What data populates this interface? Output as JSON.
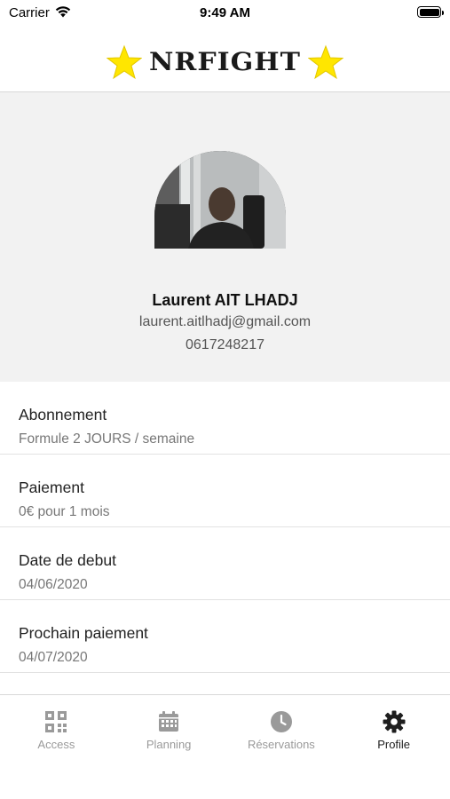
{
  "status_bar": {
    "carrier": "Carrier",
    "time": "9:49 AM"
  },
  "header": {
    "logo_text": "NRFIGHT"
  },
  "profile": {
    "name": "Laurent AIT LHADJ",
    "email": "laurent.aitlhadj@gmail.com",
    "phone": "0617248217"
  },
  "info": [
    {
      "label": "Abonnement",
      "value": "Formule 2 JOURS / semaine"
    },
    {
      "label": "Paiement",
      "value": "0€ pour 1 mois"
    },
    {
      "label": "Date de debut",
      "value": "04/06/2020"
    },
    {
      "label": "Prochain paiement",
      "value": "04/07/2020"
    }
  ],
  "tabs": [
    {
      "label": "Access",
      "icon": "qr-code-icon",
      "active": false
    },
    {
      "label": "Planning",
      "icon": "calendar-icon",
      "active": false
    },
    {
      "label": "Réservations",
      "icon": "clock-icon",
      "active": false
    },
    {
      "label": "Profile",
      "icon": "gear-icon",
      "active": true
    }
  ],
  "colors": {
    "star": "#FFE600",
    "inactive_tab": "#9A9A9A",
    "active_tab": "#1E1E1E",
    "card_bg": "#F2F2F2"
  }
}
